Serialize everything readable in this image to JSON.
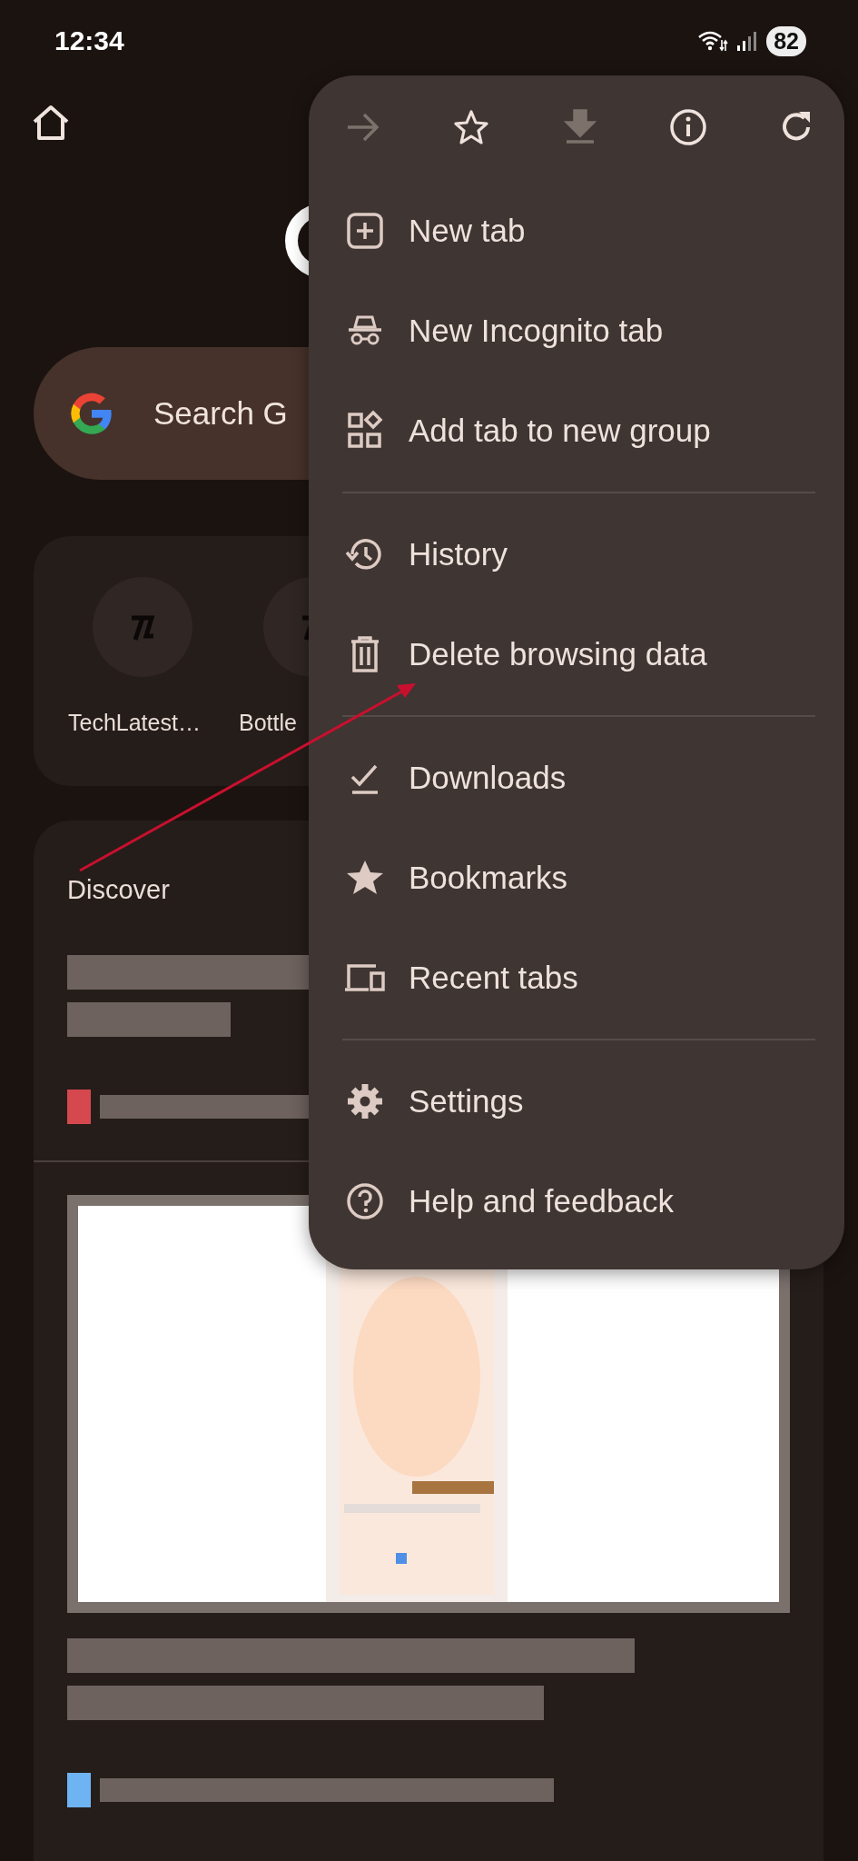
{
  "status_bar": {
    "time": "12:34",
    "battery": "82"
  },
  "search": {
    "placeholder": "Search G"
  },
  "shortcuts": [
    {
      "label": "TechLatest…"
    },
    {
      "label": "Bottle"
    }
  ],
  "discover": {
    "title": "Discover"
  },
  "menu": {
    "toolbar": [
      {
        "kind": "forward",
        "disabled": true
      },
      {
        "kind": "star",
        "disabled": false
      },
      {
        "kind": "download",
        "disabled": true
      },
      {
        "kind": "info",
        "disabled": false
      },
      {
        "kind": "refresh",
        "disabled": false
      }
    ],
    "sections": [
      [
        {
          "kind": "new-tab",
          "label": "New tab"
        },
        {
          "kind": "incognito",
          "label": "New Incognito tab"
        },
        {
          "kind": "group",
          "label": "Add tab to new group"
        }
      ],
      [
        {
          "kind": "history",
          "label": "History"
        },
        {
          "kind": "delete",
          "label": "Delete browsing data"
        }
      ],
      [
        {
          "kind": "downloads",
          "label": "Downloads"
        },
        {
          "kind": "bookmarks",
          "label": "Bookmarks"
        },
        {
          "kind": "recent",
          "label": "Recent tabs"
        }
      ],
      [
        {
          "kind": "settings",
          "label": "Settings"
        },
        {
          "kind": "help",
          "label": "Help and feedback"
        }
      ]
    ]
  }
}
